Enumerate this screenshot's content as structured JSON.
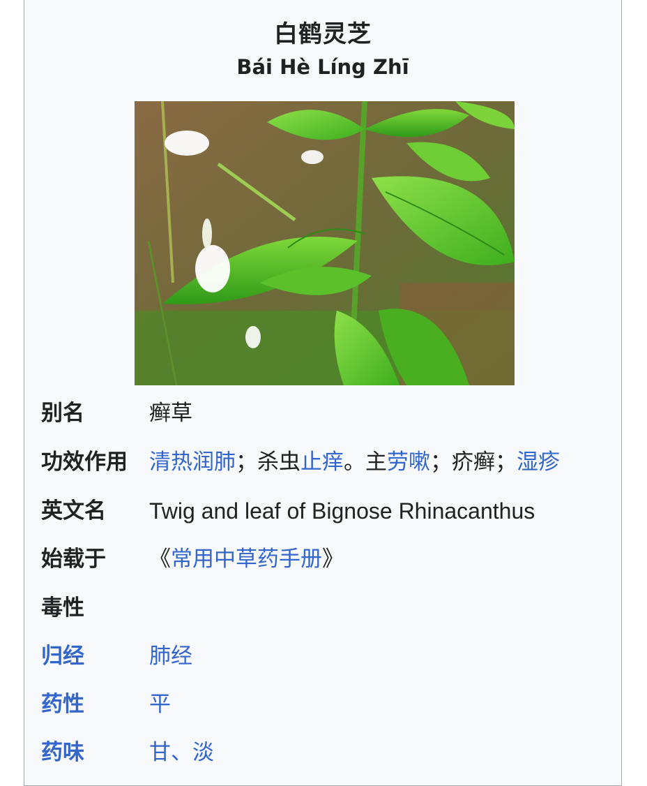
{
  "header": {
    "title": "白鹤灵芝",
    "pinyin": "Bái Hè Líng Zhī"
  },
  "image": {
    "subject": "white-flowered green plant"
  },
  "rows": {
    "alias": {
      "label": "别名",
      "value": "癣草"
    },
    "effects": {
      "label": "功效作用",
      "parts": [
        {
          "text": "清热润肺",
          "link": true
        },
        {
          "text": "；杀虫",
          "link": false
        },
        {
          "text": "止痒",
          "link": true
        },
        {
          "text": "。主",
          "link": false
        },
        {
          "text": "劳嗽",
          "link": true
        },
        {
          "text": "；疥癣；",
          "link": false
        },
        {
          "text": "湿疹",
          "link": true
        }
      ]
    },
    "english_name": {
      "label": "英文名",
      "value": "Twig and leaf of Bignose Rhinacanthus"
    },
    "first_recorded": {
      "label": "始载于",
      "open": "《",
      "book": "常用中草药手册",
      "close": "》"
    },
    "toxicity": {
      "label": "毒性",
      "value": ""
    },
    "meridian": {
      "label": "归经",
      "value": "肺经"
    },
    "nature": {
      "label": "药性",
      "value": "平"
    },
    "taste": {
      "label": "药味",
      "value": "甘、淡"
    }
  },
  "colors": {
    "link": "#3366cc",
    "text": "#202122",
    "card_bg": "#f8f9fa",
    "border": "#a2a9b1"
  }
}
